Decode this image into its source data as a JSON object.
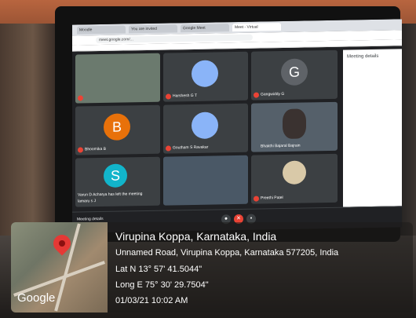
{
  "browser": {
    "tabs": [
      "Moodle",
      "You are invited",
      "Google Meet",
      "Meet - Virtual"
    ],
    "url": "meet.google.com/..."
  },
  "meeting": {
    "participants": [
      {
        "name": "",
        "color": "#5f6368"
      },
      {
        "name": "Harshesh G T",
        "color": "#8ab4f8"
      },
      {
        "name": "Gangwiddy G",
        "initial": "G",
        "color": "#5f6368"
      },
      {
        "name": "Bhoomika B",
        "initial": "B",
        "color": "#e8710a"
      },
      {
        "name": "Goutham S Ravakar",
        "color": "#8ab4f8"
      },
      {
        "name": "Bhakthi Bajaral Bajrain",
        "color": "#5f6368"
      },
      {
        "name": "lamaru s J",
        "initial": "S",
        "color": "#12b5cb"
      },
      {
        "name": "",
        "color": "#5f6368"
      },
      {
        "name": "Preethi Patel",
        "color": "#5f6368"
      }
    ],
    "notice": "Varun D Acharya has left the meeting",
    "side_title": "Meeting details",
    "bottom_left": "Meeting details"
  },
  "geotag": {
    "location": "Virupina Koppa, Karnataka, India",
    "address": "Unnamed Road, Virupina Koppa, Karnataka 577205, India",
    "lat": "Lat N 13° 57' 41.5044\"",
    "long": "Long E 75° 30' 29.7504\"",
    "datetime": "01/03/21 10:02 AM",
    "map_logo": "Google",
    "pin_icon": "map-pin-icon",
    "pin_color": "#e53935"
  }
}
